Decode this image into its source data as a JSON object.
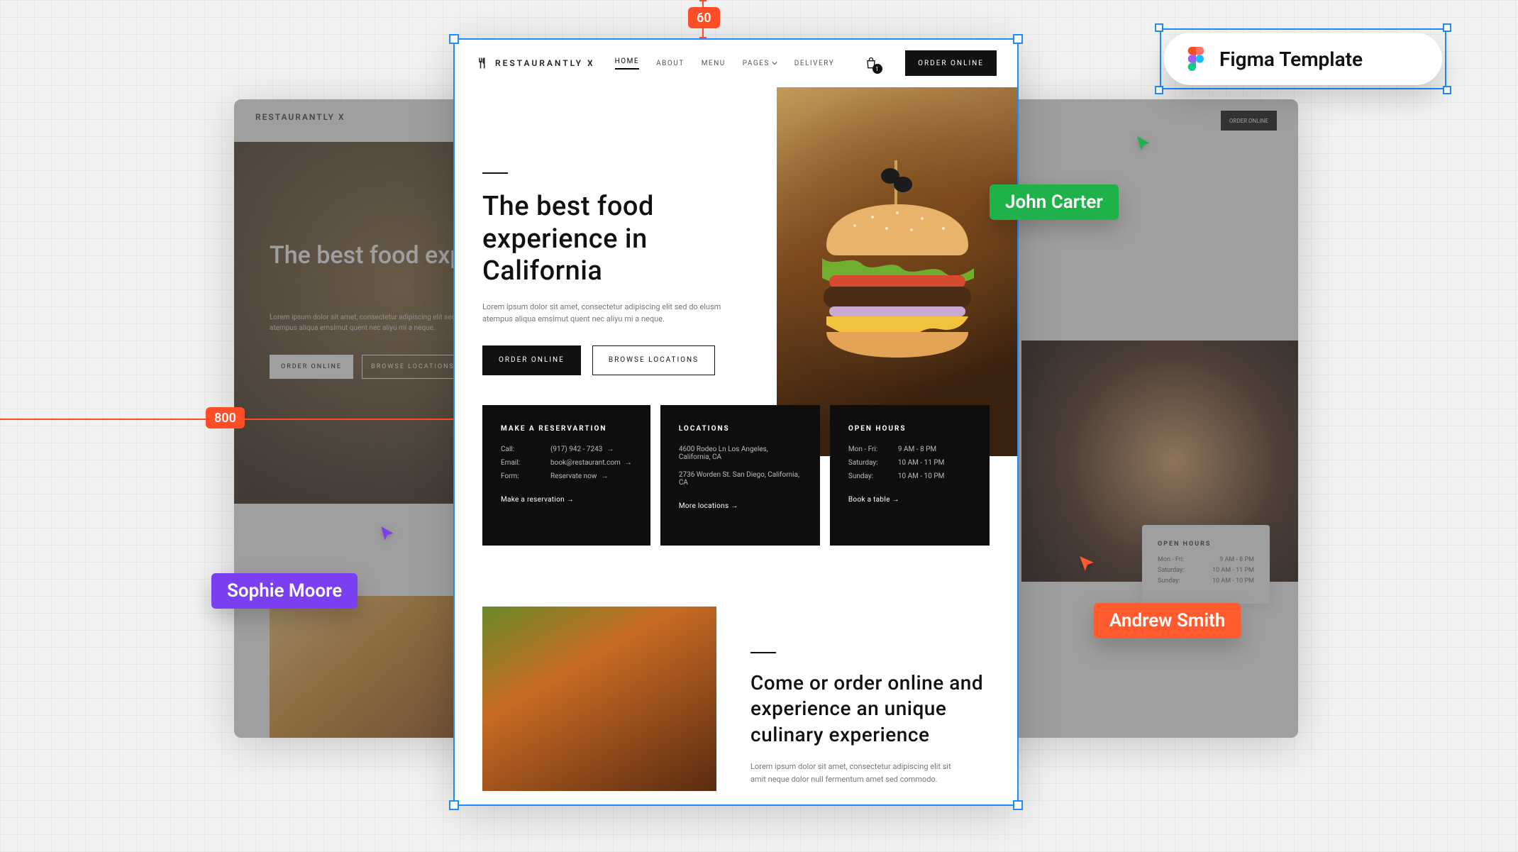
{
  "brand": "RESTAURANTLY X",
  "nav": {
    "home": "HOME",
    "about": "ABOUT",
    "menu": "MENU",
    "pages": "PAGES",
    "delivery": "DELIVERY",
    "order": "ORDER ONLINE",
    "cart_badge": "1"
  },
  "hero": {
    "headline": "The best food experience in California",
    "sub": "Lorem ipsum dolor sit amet, consectetur adipiscing elit sed do elusm atempus aliqua emsimut quent nec aliyu mi a neque.",
    "order": "ORDER ONLINE",
    "browse": "BROWSE LOCATIONS"
  },
  "cards": {
    "reserve": {
      "title": "MAKE A RESERVARTION",
      "call_k": "Call:",
      "call_v": "(917) 942 - 7243",
      "email_k": "Email:",
      "email_v": "book@restaurant.com",
      "form_k": "Form:",
      "form_v": "Reservate now",
      "more": "Make a reservation"
    },
    "locations": {
      "title": "LOCATIONS",
      "addr1": "4600 Rodeo Ln Los Angeles, California, CA",
      "addr2": "2736 Worden St. San Diego, California, CA",
      "more": "More locations"
    },
    "hours": {
      "title": "OPEN HOURS",
      "r1_k": "Mon - Fri:",
      "r1_v": "9 AM  -  8 PM",
      "r2_k": "Saturday:",
      "r2_v": "10 AM  -  11 PM",
      "r3_k": "Sunday:",
      "r3_v": "10 AM  -  10 PM",
      "more": "Book a table"
    }
  },
  "lower": {
    "headline": "Come or order online and experience an unique culinary experience",
    "sub": "Lorem ipsum dolor sit amet, consectetur adipiscing elit sit amit neque dolor null fermentum amet sed commodo."
  },
  "measurements": {
    "top": "60",
    "side": "800"
  },
  "figma_badge": "Figma Template",
  "cursors": {
    "john": "John Carter",
    "sophie": "Sophie Moore",
    "andrew": "Andrew Smith"
  },
  "back_right_card": {
    "title": "OPEN HOURS",
    "r1_k": "Mon - Fri:",
    "r1_v": "9 AM  -  8 PM",
    "r2_k": "Saturday:",
    "r2_v": "10 AM  -  11 PM",
    "r3_k": "Sunday:",
    "r3_v": "10 AM  -  10 PM"
  }
}
